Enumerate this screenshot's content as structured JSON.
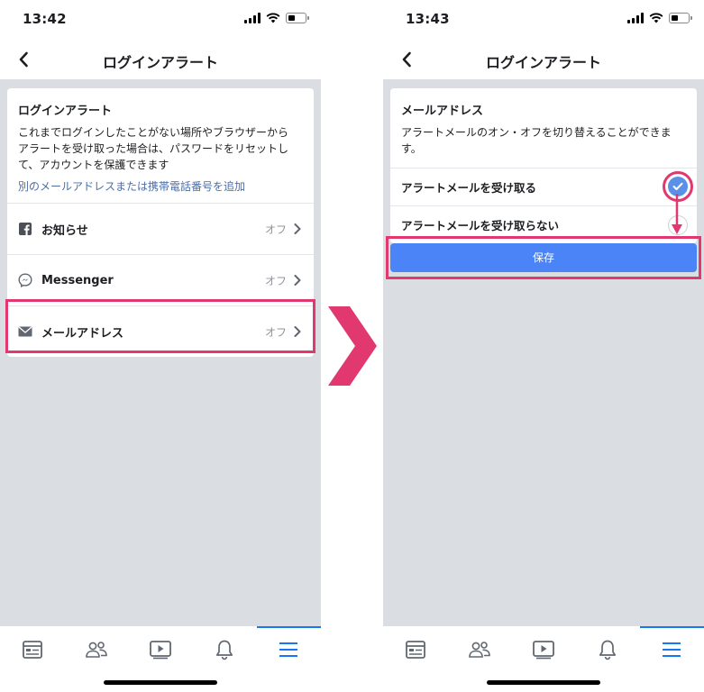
{
  "left": {
    "status_time": "13:42",
    "title": "ログインアラート",
    "info": {
      "title": "ログインアラート",
      "body_line1": "これまでログインしたことがない場所やブラウザーから",
      "body_line2": "アラートを受け取った場合は、パスワードをリセットし",
      "body_line3": "て、アカウントを保護できます",
      "link": "別のメールアドレスまたは携帯電話番号を追加"
    },
    "rows": [
      {
        "label": "お知らせ",
        "status": "オフ",
        "icon": "facebook-icon"
      },
      {
        "label": "Messenger",
        "status": "オフ",
        "icon": "messenger-icon"
      },
      {
        "label": "メールアドレス",
        "status": "オフ",
        "icon": "mail-icon"
      }
    ]
  },
  "right": {
    "status_time": "13:43",
    "title": "ログインアラート",
    "info": {
      "title": "メールアドレス",
      "body_line1": "アラートメールのオン・オフを切り替えることができま",
      "body_line2": "す。"
    },
    "options": [
      {
        "label": "アラートメールを受け取る",
        "selected": true
      },
      {
        "label": "アラートメールを受け取らない",
        "selected": false
      }
    ],
    "save_label": "保存"
  },
  "tabs": [
    "news-feed-icon",
    "friends-icon",
    "watch-icon",
    "notifications-icon",
    "menu-icon"
  ],
  "colors": {
    "accent": "#1877f2",
    "highlight": "#e0386f",
    "save_button": "#4a84f7",
    "link": "#4b6ea8",
    "background_gray": "#dadde1"
  }
}
